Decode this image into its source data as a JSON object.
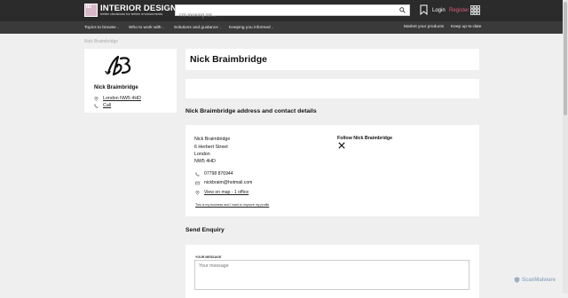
{
  "header": {
    "logo_name": "INTERIOR DESIGN",
    "logo_tagline": "better decisions for better environments",
    "logo_box_text": "ID",
    "search_placeholder": "I'm looking for...",
    "login": "Login",
    "register": "Register",
    "accent_color": "#e05a7a"
  },
  "nav": {
    "items": [
      "Topics to browse",
      "Who to work with",
      "Solutions and guidance",
      "Keeping you informed"
    ],
    "right_items": [
      "Market your products",
      "Keep up-to-date"
    ]
  },
  "breadcrumb": "Nick Braimbridge",
  "profile": {
    "name": "Nick Braimbridge",
    "location": "London NW5 4HD",
    "call": "Call"
  },
  "page_title": "Nick Braimbridge",
  "contact_section": {
    "heading": "Nick Braimbridge address and contact details",
    "name": "Nick Braimbridge",
    "address": [
      "6 Herbert Street",
      "London",
      "NW5 4HD"
    ],
    "follow_label": "Follow Nick Braimbridge",
    "phone": "07798 876944",
    "email": "nickbraim@hotmail.com",
    "map_link": "View on map - 1 office",
    "business_link": "This is my business and I want to improve my profile"
  },
  "enquiry": {
    "heading": "Send Enquiry",
    "message_label": "YOUR MESSAGE",
    "message_placeholder": "Your message"
  },
  "watermark": "ScanMalware"
}
